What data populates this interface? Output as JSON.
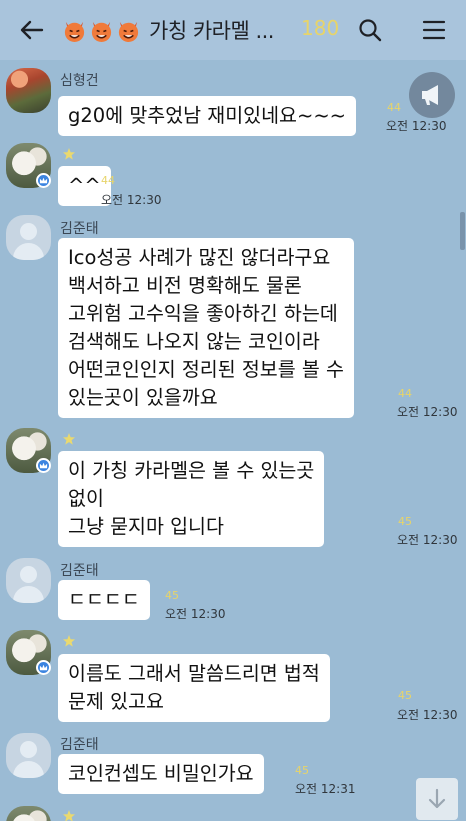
{
  "header": {
    "title": "가칭 카라멜 ...",
    "member_count": "180",
    "title_emojis": [
      "devil-emoji-icon",
      "devil-emoji-icon",
      "devil-emoji-icon"
    ],
    "icons": {
      "back": "arrow-left-icon",
      "search": "search-icon",
      "menu": "hamburger-menu-icon"
    }
  },
  "colors": {
    "background": "#9bbbd4",
    "header": "#a9c4dc",
    "unread": "#e7d46a",
    "bubble": "#ffffff"
  },
  "messages": [
    {
      "sender": "심형건",
      "lines": [
        "g20에 맞추었남 재미있네요~~~"
      ],
      "unread": "44",
      "time": "오전 12:30"
    },
    {
      "sender": "",
      "lines": [
        "^^"
      ],
      "unread": "44",
      "time": "오전 12:30"
    },
    {
      "sender": "김준태",
      "lines": [
        "Ico성공 사례가 많진 않더라구요",
        "백서하고 비전 명확해도 물론",
        "고위험 고수익을 좋아하긴 하는데",
        "검색해도 나오지 않는 코인이라",
        "어떤코인인지 정리된 정보를 볼 수",
        "있는곳이 있을까요"
      ],
      "unread": "44",
      "time": "오전 12:30"
    },
    {
      "sender": "",
      "lines": [
        "이 가칭 카라멜은 볼 수 있는곳",
        "없이",
        "그냥 묻지마 입니다"
      ],
      "unread": "45",
      "time": "오전 12:30"
    },
    {
      "sender": "김준태",
      "lines": [
        "ㄷㄷㄷㄷ"
      ],
      "unread": "45",
      "time": "오전 12:30"
    },
    {
      "sender": "",
      "lines": [
        "이름도 그래서 말씀드리면 법적",
        "문제 있고요"
      ],
      "unread": "45",
      "time": "오전 12:30"
    },
    {
      "sender": "김준태",
      "lines": [
        "코인컨셉도 비밀인가요"
      ],
      "unread": "45",
      "time": "오전 12:31"
    }
  ],
  "overlay": {
    "notice_icon": "megaphone-icon",
    "scroll_down_icon": "arrow-down-icon"
  }
}
